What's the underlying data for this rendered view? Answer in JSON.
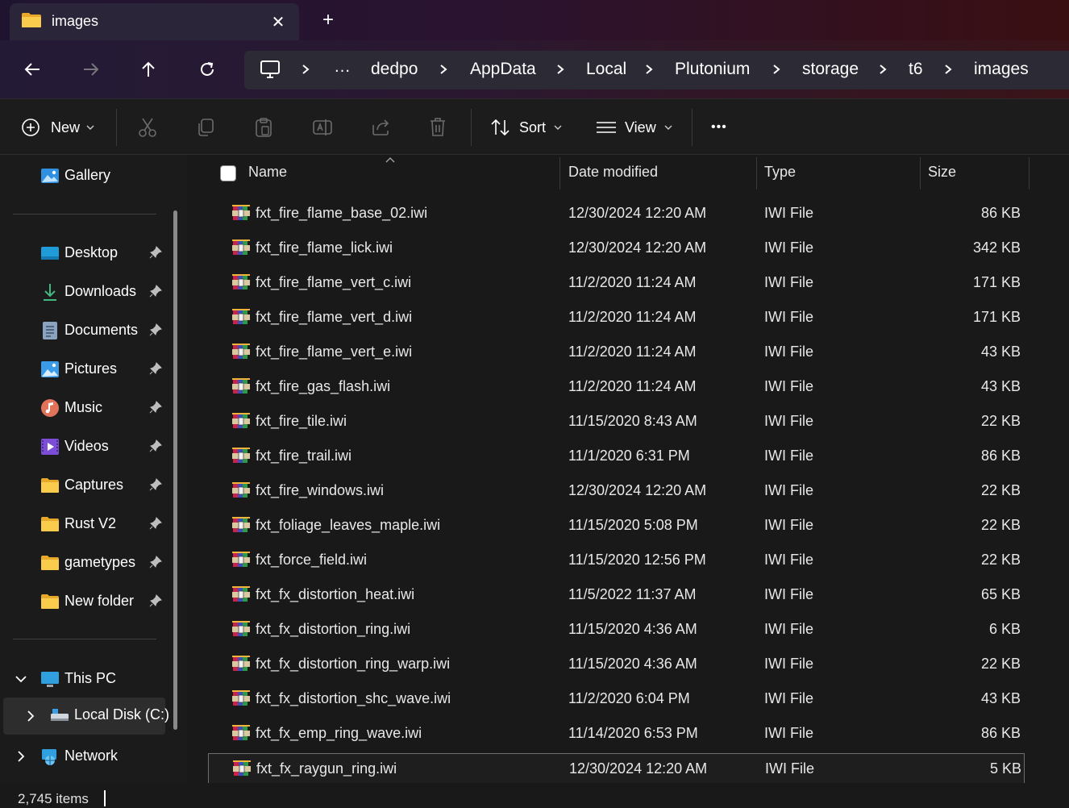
{
  "tab": {
    "title": "images",
    "close_glyph": "✕",
    "new_glyph": "+"
  },
  "breadcrumb": {
    "overflow": "…",
    "items": [
      "dedpo",
      "AppData",
      "Local",
      "Plutonium",
      "storage",
      "t6",
      "images"
    ]
  },
  "commands": {
    "new_label": "New",
    "sort_label": "Sort",
    "view_label": "View",
    "more_glyph": "•••"
  },
  "sidebar": {
    "gallery": "Gallery",
    "quick": [
      "Desktop",
      "Downloads",
      "Documents",
      "Pictures",
      "Music",
      "Videos",
      "Captures",
      "Rust V2",
      "gametypes",
      "New folder"
    ],
    "this_pc": "This PC",
    "local_disk": "Local Disk (C:)",
    "network": "Network"
  },
  "columns": {
    "name": "Name",
    "date": "Date modified",
    "type": "Type",
    "size": "Size"
  },
  "files": [
    {
      "name": "fxt_fire_flame_base_02.iwi",
      "date": "12/30/2024 12:20 AM",
      "type": "IWI File",
      "size": "86 KB"
    },
    {
      "name": "fxt_fire_flame_lick.iwi",
      "date": "12/30/2024 12:20 AM",
      "type": "IWI File",
      "size": "342 KB"
    },
    {
      "name": "fxt_fire_flame_vert_c.iwi",
      "date": "11/2/2020 11:24 AM",
      "type": "IWI File",
      "size": "171 KB"
    },
    {
      "name": "fxt_fire_flame_vert_d.iwi",
      "date": "11/2/2020 11:24 AM",
      "type": "IWI File",
      "size": "171 KB"
    },
    {
      "name": "fxt_fire_flame_vert_e.iwi",
      "date": "11/2/2020 11:24 AM",
      "type": "IWI File",
      "size": "43 KB"
    },
    {
      "name": "fxt_fire_gas_flash.iwi",
      "date": "11/2/2020 11:24 AM",
      "type": "IWI File",
      "size": "43 KB"
    },
    {
      "name": "fxt_fire_tile.iwi",
      "date": "11/15/2020 8:43 AM",
      "type": "IWI File",
      "size": "22 KB"
    },
    {
      "name": "fxt_fire_trail.iwi",
      "date": "11/1/2020 6:31 PM",
      "type": "IWI File",
      "size": "86 KB"
    },
    {
      "name": "fxt_fire_windows.iwi",
      "date": "12/30/2024 12:20 AM",
      "type": "IWI File",
      "size": "22 KB"
    },
    {
      "name": "fxt_foliage_leaves_maple.iwi",
      "date": "11/15/2020 5:08 PM",
      "type": "IWI File",
      "size": "22 KB"
    },
    {
      "name": "fxt_force_field.iwi",
      "date": "11/15/2020 12:56 PM",
      "type": "IWI File",
      "size": "22 KB"
    },
    {
      "name": "fxt_fx_distortion_heat.iwi",
      "date": "11/5/2022 11:37 AM",
      "type": "IWI File",
      "size": "65 KB"
    },
    {
      "name": "fxt_fx_distortion_ring.iwi",
      "date": "11/15/2020 4:36 AM",
      "type": "IWI File",
      "size": "6 KB"
    },
    {
      "name": "fxt_fx_distortion_ring_warp.iwi",
      "date": "11/15/2020 4:36 AM",
      "type": "IWI File",
      "size": "22 KB"
    },
    {
      "name": "fxt_fx_distortion_shc_wave.iwi",
      "date": "11/2/2020 6:04 PM",
      "type": "IWI File",
      "size": "43 KB"
    },
    {
      "name": "fxt_fx_emp_ring_wave.iwi",
      "date": "11/14/2020 6:53 PM",
      "type": "IWI File",
      "size": "86 KB"
    },
    {
      "name": "fxt_fx_raygun_ring.iwi",
      "date": "12/30/2024 12:20 AM",
      "type": "IWI File",
      "size": "5 KB"
    }
  ],
  "status": {
    "items": "2,745 items"
  },
  "colors": {
    "accent": "#4cc2ff",
    "folder": "#f7c744"
  }
}
